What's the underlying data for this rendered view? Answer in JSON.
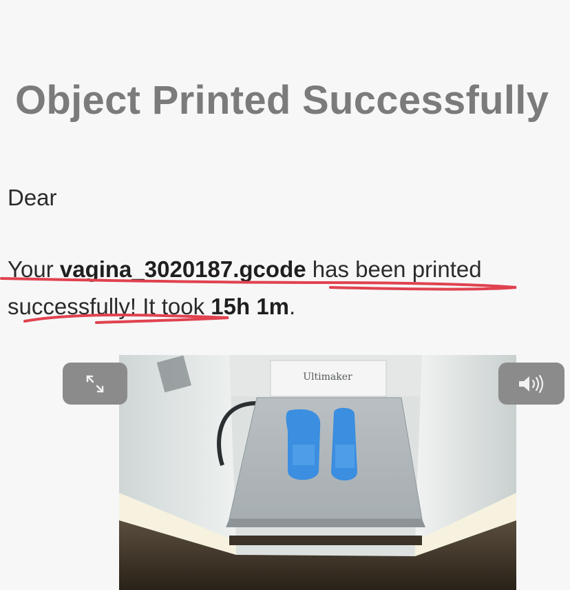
{
  "title": "Object Printed Successfully",
  "greeting": "Dear",
  "message": {
    "prefix": "Your ",
    "filename": "vagina_3020187.gcode",
    "middle": " has been printed successfully! It took ",
    "duration": "15h 1m",
    "suffix": "."
  },
  "image": {
    "brand_label": "Ultimaker",
    "controls": {
      "expand_icon": "expand-icon",
      "audio_icon": "speaker-icon"
    }
  },
  "colors": {
    "title": "#7b7b7b",
    "annotation": "#e0424f",
    "control_bg": "#8b8b8b",
    "print_blue": "#3b8ee0"
  }
}
